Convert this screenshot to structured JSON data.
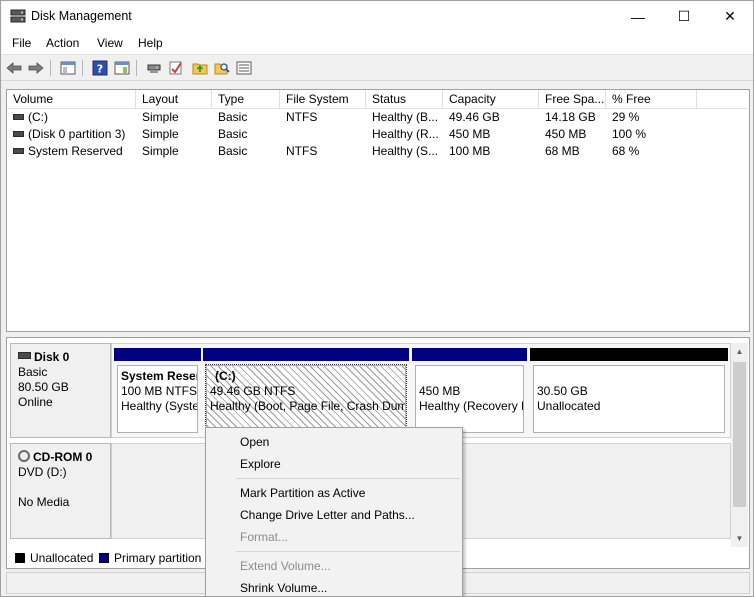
{
  "window": {
    "title": "Disk Management",
    "controls": {
      "minimize": "—",
      "maximize": "☐",
      "close": "✕"
    }
  },
  "menu": [
    "File",
    "Action",
    "View",
    "Help"
  ],
  "toolbar": {
    "icons": [
      "back-icon",
      "forward-icon",
      "console-tree-icon",
      "help-icon",
      "properties-icon",
      "connect-icon",
      "check-icon",
      "folder-up-icon",
      "search-icon",
      "list-icon"
    ]
  },
  "volume_list": {
    "columns": [
      "Volume",
      "Layout",
      "Type",
      "File System",
      "Status",
      "Capacity",
      "Free Spa...",
      "% Free"
    ],
    "rows": [
      {
        "volume": "(C:)",
        "layout": "Simple",
        "type": "Basic",
        "fs": "NTFS",
        "status": "Healthy (B...",
        "capacity": "49.46 GB",
        "free": "14.18 GB",
        "pct": "29 %"
      },
      {
        "volume": "(Disk 0 partition 3)",
        "layout": "Simple",
        "type": "Basic",
        "fs": "",
        "status": "Healthy (R...",
        "capacity": "450 MB",
        "free": "450 MB",
        "pct": "100 %"
      },
      {
        "volume": "System Reserved",
        "layout": "Simple",
        "type": "Basic",
        "fs": "NTFS",
        "status": "Healthy (S...",
        "capacity": "100 MB",
        "free": "68 MB",
        "pct": "68 %"
      }
    ]
  },
  "disks": {
    "disk0": {
      "name": "Disk 0",
      "type": "Basic",
      "size": "80.50 GB",
      "state": "Online",
      "partitions": [
        {
          "name": "System Reser",
          "size": "100 MB NTFS",
          "status": "Healthy (Syste"
        },
        {
          "name": "(C:)",
          "size": "49.46 GB NTFS",
          "status": "Healthy (Boot, Page File, Crash Dump"
        },
        {
          "name": "",
          "size": "450 MB",
          "status": "Healthy (Recovery P"
        },
        {
          "name": "",
          "size": "30.50 GB",
          "status": "Unallocated"
        }
      ]
    },
    "cdrom0": {
      "name": "CD-ROM 0",
      "type": "DVD (D:)",
      "state": "No Media"
    }
  },
  "legend": [
    {
      "label": "Unallocated",
      "color": "#000000"
    },
    {
      "label": "Primary partition",
      "color": "#000080"
    }
  ],
  "colors": {
    "primary_partition": "#000080",
    "unallocated": "#000000"
  },
  "context_menu": {
    "items": [
      {
        "label": "Open",
        "enabled": true
      },
      {
        "label": "Explore",
        "enabled": true
      },
      {
        "label": "Mark Partition as Active",
        "enabled": true
      },
      {
        "label": "Change Drive Letter and Paths...",
        "enabled": true
      },
      {
        "label": "Format...",
        "enabled": false
      },
      {
        "label": "Extend Volume...",
        "enabled": false
      },
      {
        "label": "Shrink Volume...",
        "enabled": true
      }
    ]
  }
}
